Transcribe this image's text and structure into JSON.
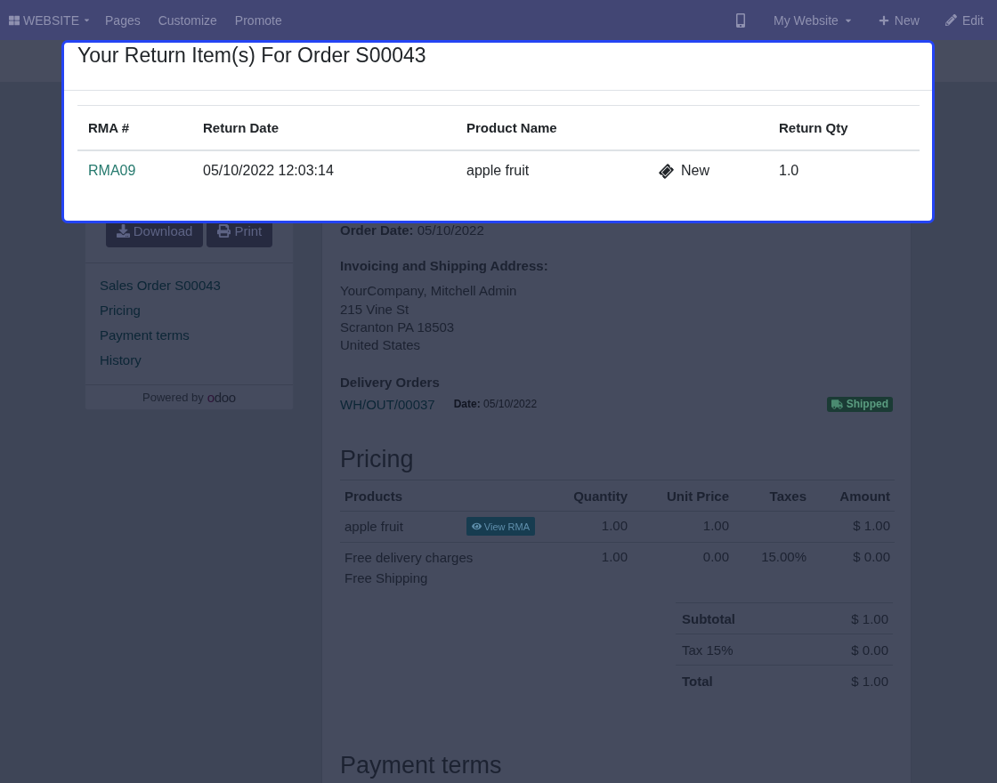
{
  "navbar": {
    "menu": "WEBSITE",
    "links": [
      "Pages",
      "Customize",
      "Promote"
    ],
    "actions": [
      {
        "kind": "mobile"
      },
      {
        "kind": "dropdown",
        "label": "My Website"
      },
      {
        "kind": "new",
        "label": "New"
      },
      {
        "kind": "edit",
        "label": "Edit"
      }
    ]
  },
  "modal": {
    "title": "Your Return Item(s) For Order S00043",
    "columns": {
      "rma": "RMA #",
      "return_date": "Return Date",
      "product_name": "Product Name",
      "return_qty": "Return Qty"
    },
    "rows": [
      {
        "rma": "RMA09",
        "return_date": "05/10/2022 12:03:14",
        "product_name": "apple fruit",
        "column_4": "New",
        "return_qty": "1.0"
      }
    ]
  },
  "sidebar": {
    "buttons": [
      {
        "kind": "download",
        "label": "Download"
      },
      {
        "kind": "print",
        "label": "Print"
      }
    ],
    "links": [
      "Sales Order S00043",
      "Pricing",
      "Payment terms",
      "History"
    ],
    "powered_by": "Powered by",
    "brand": "odoo"
  },
  "order": {
    "order_date": "**Order Date:** 05/10/2022",
    "address_heading": "Invoicing and Shipping Address:",
    "address_name": "YourCompany, Mitchell Admin",
    "address_lines": [
      "215 Vine St",
      "Scranton PA 18503",
      "United States"
    ],
    "delivery_heading": "Delivery Orders",
    "deliveries": [
      {
        "reference": "WH/OUT/00037",
        "date": "**Date:** 05/10/2022",
        "status": "Shipped"
      }
    ]
  },
  "pricing": {
    "heading": "Pricing",
    "columns": [
      "Products",
      "Quantity",
      "Unit Price",
      "Taxes",
      "Amount"
    ],
    "rows": [
      {
        "product": "apple fruit",
        "action": "View RMA",
        "quantity": "1.00",
        "unit_price": "1.00",
        "amount": "$ 1.00"
      },
      {
        "product": "Free delivery charges",
        "note": "Free Shipping",
        "quantity": "1.00",
        "unit_price": "0.00",
        "taxes": "15.00%",
        "amount": "$ 0.00"
      }
    ],
    "totals": [
      {
        "kind": "subtotal",
        "label": "Subtotal",
        "value": "$ 1.00"
      },
      {
        "kind": "tax",
        "label": "Tax 15%",
        "value": "$ 0.00"
      },
      {
        "kind": "total",
        "label": "Total",
        "value": "$ 1.00"
      }
    ]
  },
  "payment_terms": {
    "heading": "Payment terms"
  }
}
